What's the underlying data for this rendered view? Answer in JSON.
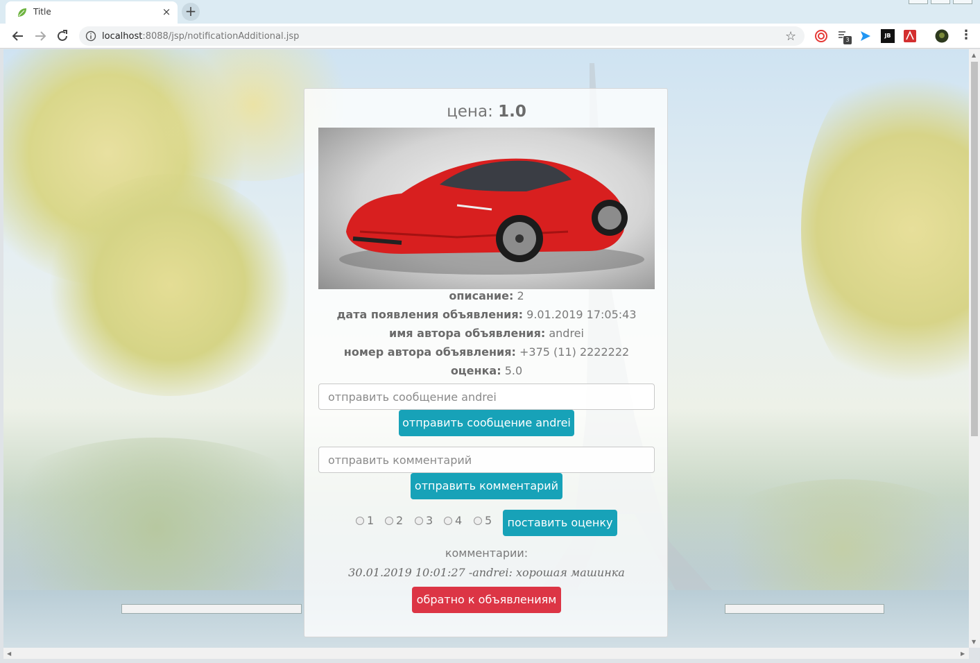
{
  "browser": {
    "tab_title": "Title",
    "tab_close": "×",
    "new_tab": "+",
    "url_host": "localhost",
    "url_rest": ":8088/jsp/notificationAdditional.jsp",
    "extension_badge": "3",
    "menu": "⋮"
  },
  "notice": {
    "price_label": "цена:",
    "price_value": "1.0",
    "description_label": "описание:",
    "description_value": "2",
    "date_label": "дата появления объявления:",
    "date_value": "9.01.2019 17:05:43",
    "author_name_label": "имя автора объявления:",
    "author_name_value": "andrei",
    "author_phone_label": "номер автора объявления:",
    "author_phone_value": "+375 (11) 2222222",
    "rating_label": "оценка:",
    "rating_value": "5.0"
  },
  "message_form": {
    "placeholder": "отправить сообщение andrei",
    "button": "отправить сообщение andrei"
  },
  "comment_form": {
    "placeholder": "отправить комментарий",
    "button": "отправить комментарий"
  },
  "rating_form": {
    "options": [
      "1",
      "2",
      "3",
      "4",
      "5"
    ],
    "button": "поставить оценку"
  },
  "comments": {
    "title": "комментарии:",
    "items": [
      "30.01.2019 10:01:27 -andrei: хорошая машинка"
    ]
  },
  "back_button": "обратно к объявлениям",
  "colors": {
    "info": "#17a2b8",
    "danger": "#dc3545"
  }
}
